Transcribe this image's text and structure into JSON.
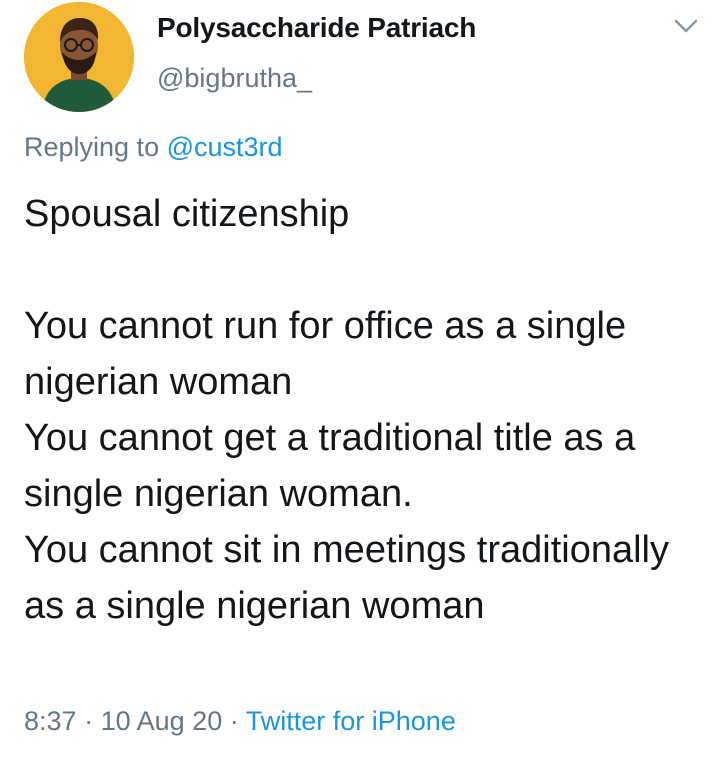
{
  "author": {
    "display_name": "Polysaccharide Patriach",
    "handle": "@bigbrutha_",
    "avatar_icon": "avatar-illustration-icon"
  },
  "reply": {
    "prefix": "Replying to",
    "mention": "@cust3rd"
  },
  "tweet": {
    "line_1": "Spousal citizenship",
    "line_2": "You cannot run for office as a single nigerian woman",
    "line_3": "You cannot get a traditional title as a single nigerian woman.",
    "line_4": "You cannot sit in meetings traditionally as a single nigerian woman"
  },
  "meta": {
    "time": "8:37",
    "separator_1": "·",
    "date": "10 Aug 20",
    "separator_2": "·",
    "source": "Twitter for iPhone"
  },
  "colors": {
    "accent": "#1b95e0",
    "secondary_text": "#657786",
    "primary_text": "#14171a",
    "avatar_bg": "#f2b632"
  },
  "icons": {
    "menu": "chevron-down-icon"
  }
}
